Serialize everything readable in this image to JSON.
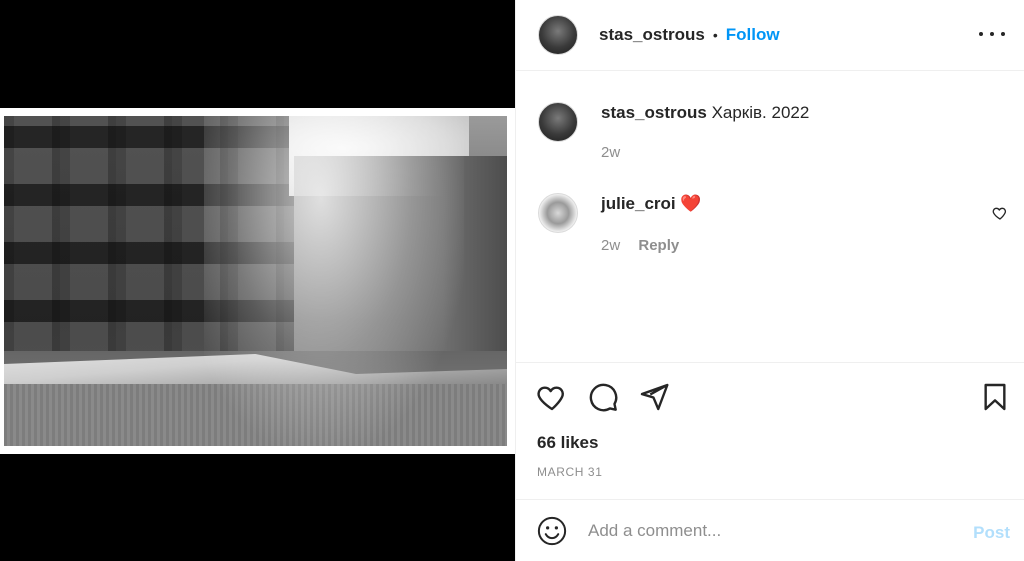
{
  "media": {
    "image_alt": "Black and white photo of damaged buildings and rubble on a snowy street"
  },
  "header": {
    "username": "stas_ostrous",
    "separator": "•",
    "follow_label": "Follow"
  },
  "caption": {
    "username": "stas_ostrous",
    "text": "Харків. 2022",
    "time": "2w"
  },
  "comments": [
    {
      "username": "julie_croi",
      "text": "❤️",
      "time": "2w",
      "reply_label": "Reply"
    }
  ],
  "actions": {
    "likes": "66 likes",
    "date": "MARCH 31"
  },
  "add_comment": {
    "placeholder": "Add a comment...",
    "post_label": "Post"
  },
  "colors": {
    "accent": "#0095f6",
    "post_disabled": "#b2dffc",
    "muted": "#8e8e8e",
    "heart": "#ed4956"
  }
}
